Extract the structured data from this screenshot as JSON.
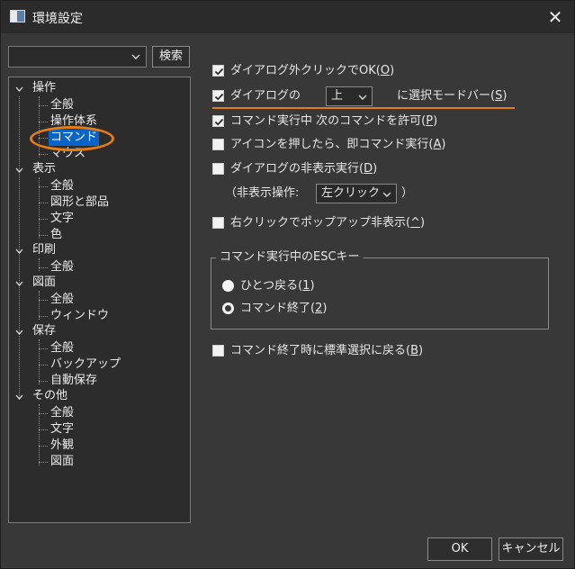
{
  "window": {
    "title": "環境設定",
    "close_glyph": "✕"
  },
  "search": {
    "combo_value": "",
    "button_label": "検索"
  },
  "tree": {
    "groups": [
      {
        "label": "操作",
        "children": [
          "全般",
          "操作体系",
          "コマンド",
          "マウス"
        ],
        "selected": "コマンド"
      },
      {
        "label": "表示",
        "children": [
          "全般",
          "図形と部品",
          "文字",
          "色"
        ]
      },
      {
        "label": "印刷",
        "children": [
          "全般"
        ]
      },
      {
        "label": "図面",
        "children": [
          "全般",
          "ウィンドウ"
        ]
      },
      {
        "label": "保存",
        "children": [
          "全般",
          "バックアップ",
          "自動保存"
        ]
      },
      {
        "label": "その他",
        "children": [
          "全般",
          "文字",
          "外観",
          "図面"
        ]
      }
    ]
  },
  "options": {
    "outside_click_ok": {
      "label": "ダイアログ外クリックでOK(",
      "key": "O",
      "suffix": ")",
      "checked": true
    },
    "select_mode_bar": {
      "label_pre": "ダイアログの",
      "position_value": "上",
      "label_post": "に選択モードバー(",
      "key": "S",
      "suffix": ")",
      "checked": true
    },
    "allow_next_command": {
      "label": "コマンド実行中 次のコマンドを許可(",
      "key": "P",
      "suffix": ")",
      "checked": true
    },
    "icon_press_execute": {
      "label": "アイコンを押したら、即コマンド実行(",
      "key": "A",
      "suffix": ")",
      "checked": false
    },
    "hide_dialog": {
      "label": "ダイアログの非表示実行(",
      "key": "D",
      "suffix": ")",
      "checked": false
    },
    "hide_operation": {
      "label_pre": "（非表示操作:",
      "value": "左クリック",
      "label_post": "）"
    },
    "right_click_popup": {
      "label": "右クリックでポップアップ非表示(",
      "key": "^",
      "suffix": ")",
      "checked": false
    },
    "esc_group": {
      "title": "コマンド実行中のESCキー",
      "step_back": {
        "label": "ひとつ戻る(",
        "key": "1",
        "suffix": ")",
        "selected": true
      },
      "end_command": {
        "label": "コマンド終了(",
        "key": "2",
        "suffix": ")",
        "selected": false
      }
    },
    "return_standard_select": {
      "label": "コマンド終了時に標準選択に戻る(",
      "key": "B",
      "suffix": ")",
      "checked": false
    }
  },
  "footer": {
    "ok_label": "OK",
    "cancel_label": "キャンセル"
  },
  "colors": {
    "accent_annotation": "#e37d17",
    "selection": "#0a64c8"
  }
}
